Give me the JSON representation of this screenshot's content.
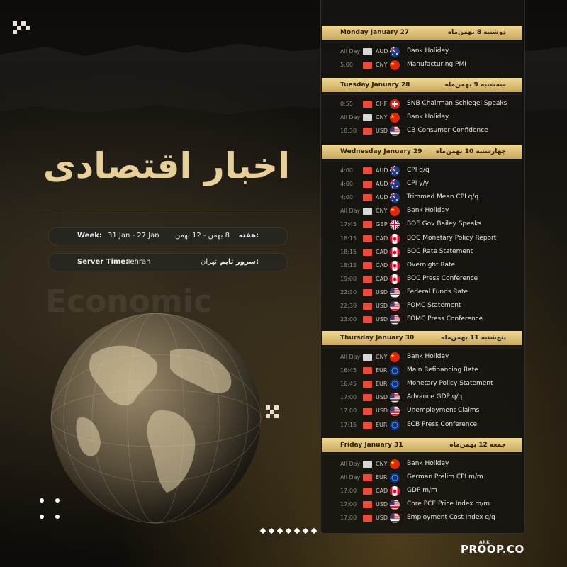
{
  "headline": "اخبار اقتصادی",
  "week": {
    "label_en": "Week:",
    "range_en": "31 Jan - 27 Jan",
    "range_fa": "8 بهمن - 12 بهمن",
    "label_fa": "هفته:"
  },
  "server": {
    "label_en": "Server Time:",
    "value_en": "Tehran",
    "value_fa": "تهران",
    "label_fa": "سرور تایم:"
  },
  "watermark": "Economic",
  "brand": "PROOP.CO",
  "brand_pre": "ARK",
  "colors": {
    "gold": "#e6cf9b",
    "header": "#d9bd76",
    "folder_red": "#e84c3d",
    "folder_grey": "#d7d7d7"
  },
  "days": [
    {
      "en": "Monday January 27",
      "fa": "دوشنبه 8 بهمن‌ماه",
      "events": [
        {
          "time": "All Day",
          "cur": "AUD",
          "flag": "au",
          "impact": "low",
          "title": "Bank Holiday"
        },
        {
          "time": "5:00",
          "cur": "CNY",
          "flag": "cn",
          "impact": "high",
          "title": "Manufacturing PMI"
        }
      ]
    },
    {
      "en": "Tuesday January 28",
      "fa": "سه‌شنبه 9 بهمن‌ماه",
      "events": [
        {
          "time": "0:55",
          "cur": "CHF",
          "flag": "ch",
          "impact": "high",
          "title": "SNB Chairman Schlegel Speaks"
        },
        {
          "time": "All Day",
          "cur": "CNY",
          "flag": "cn",
          "impact": "low",
          "title": "Bank Holiday"
        },
        {
          "time": "18:30",
          "cur": "USD",
          "flag": "us",
          "impact": "high",
          "title": "CB Consumer Confidence"
        }
      ]
    },
    {
      "en": "Wednesday January 29",
      "fa": "چهارشنبه 10 بهمن‌ماه",
      "events": [
        {
          "time": "4:00",
          "cur": "AUD",
          "flag": "au",
          "impact": "high",
          "title": "CPI q/q"
        },
        {
          "time": "4:00",
          "cur": "AUD",
          "flag": "au",
          "impact": "high",
          "title": "CPI y/y"
        },
        {
          "time": "4:00",
          "cur": "AUD",
          "flag": "au",
          "impact": "high",
          "title": "Trimmed Mean CPI q/q"
        },
        {
          "time": "All Day",
          "cur": "CNY",
          "flag": "cn",
          "impact": "low",
          "title": "Bank Holiday"
        },
        {
          "time": "17:45",
          "cur": "GBP",
          "flag": "gb",
          "impact": "high",
          "title": "BOE Gov Bailey Speaks"
        },
        {
          "time": "18:15",
          "cur": "CAD",
          "flag": "ca",
          "impact": "high",
          "title": "BOC Monetary Policy Report"
        },
        {
          "time": "18:15",
          "cur": "CAD",
          "flag": "ca",
          "impact": "high",
          "title": "BOC Rate Statement"
        },
        {
          "time": "18:15",
          "cur": "CAD",
          "flag": "ca",
          "impact": "high",
          "title": "Overnight Rate"
        },
        {
          "time": "19:00",
          "cur": "CAD",
          "flag": "ca",
          "impact": "high",
          "title": "BOC Press Conference"
        },
        {
          "time": "22:30",
          "cur": "USD",
          "flag": "us",
          "impact": "high",
          "title": "Federal Funds Rate"
        },
        {
          "time": "22:30",
          "cur": "USD",
          "flag": "us",
          "impact": "high",
          "title": "FOMC Statement"
        },
        {
          "time": "23:00",
          "cur": "USD",
          "flag": "us",
          "impact": "high",
          "title": "FOMC Press Conference"
        }
      ]
    },
    {
      "en": "Thursday January 30",
      "fa": "پنج‌شنبه 11 بهمن‌ماه",
      "events": [
        {
          "time": "All Day",
          "cur": "CNY",
          "flag": "cn",
          "impact": "low",
          "title": "Bank Holiday"
        },
        {
          "time": "16:45",
          "cur": "EUR",
          "flag": "eu",
          "impact": "high",
          "title": "Main Refinancing Rate"
        },
        {
          "time": "16:45",
          "cur": "EUR",
          "flag": "eu",
          "impact": "high",
          "title": "Monetary Policy Statement"
        },
        {
          "time": "17:00",
          "cur": "USD",
          "flag": "us",
          "impact": "high",
          "title": "Advance GDP q/q"
        },
        {
          "time": "17:00",
          "cur": "USD",
          "flag": "us",
          "impact": "high",
          "title": "Unemployment Claims"
        },
        {
          "time": "17:15",
          "cur": "EUR",
          "flag": "eu",
          "impact": "high",
          "title": "ECB Press Conference"
        }
      ]
    },
    {
      "en": "Friday January 31",
      "fa": "جمعه 12 بهمن‌ماه",
      "events": [
        {
          "time": "All Day",
          "cur": "CNY",
          "flag": "cn",
          "impact": "low",
          "title": "Bank Holiday"
        },
        {
          "time": "All Day",
          "cur": "EUR",
          "flag": "eu",
          "impact": "high",
          "title": "German Prelim CPI m/m"
        },
        {
          "time": "17:00",
          "cur": "CAD",
          "flag": "ca",
          "impact": "high",
          "title": "GDP m/m"
        },
        {
          "time": "17:00",
          "cur": "USD",
          "flag": "us",
          "impact": "high",
          "title": "Core PCE Price Index m/m"
        },
        {
          "time": "17:00",
          "cur": "USD",
          "flag": "us",
          "impact": "high",
          "title": "Employment Cost Index q/q"
        }
      ]
    }
  ]
}
